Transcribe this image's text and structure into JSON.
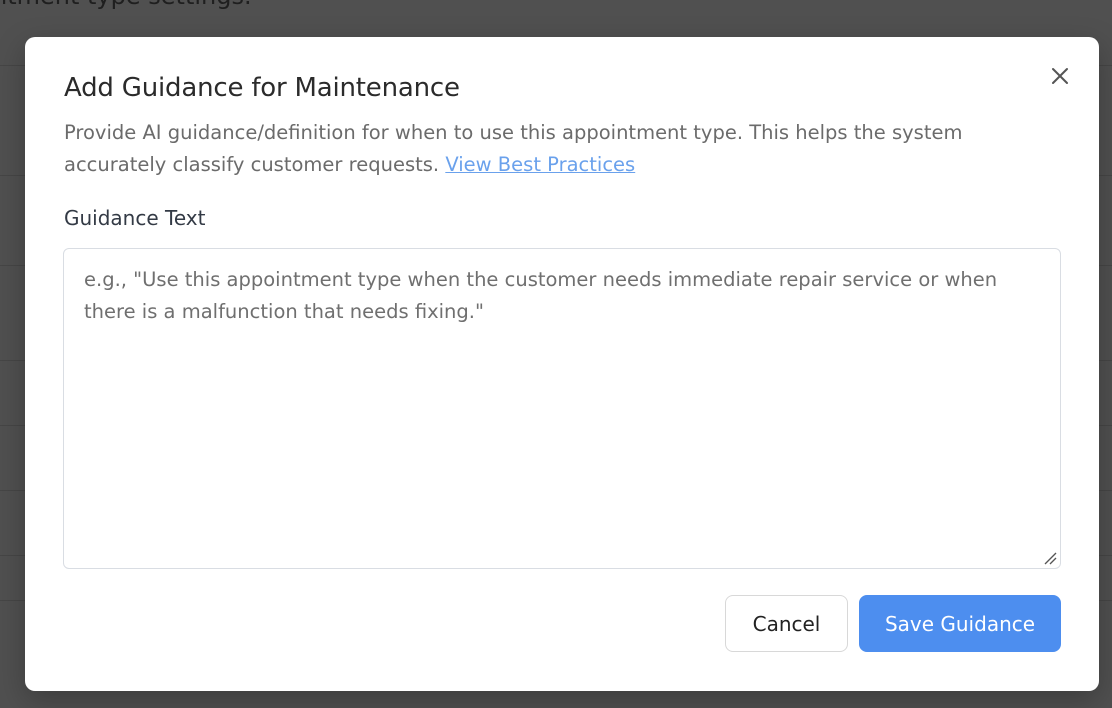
{
  "background": {
    "title_fragment": "ntment type settings."
  },
  "modal": {
    "title": "Add Guidance for Maintenance",
    "description_text": "Provide AI guidance/definition for when to use this appointment type. This helps the system accurately classify customer requests.",
    "best_practices_link": "View Best Practices",
    "field_label": "Guidance Text",
    "textarea": {
      "value": "",
      "placeholder": "e.g., \"Use this appointment type when the customer needs immediate repair service or when there is a malfunction that needs fixing.\""
    },
    "cancel_label": "Cancel",
    "save_label": "Save Guidance",
    "close_icon": "close-icon"
  },
  "colors": {
    "accent": "#4d8eef",
    "link": "#6aa1ec",
    "overlay": "#505050"
  }
}
